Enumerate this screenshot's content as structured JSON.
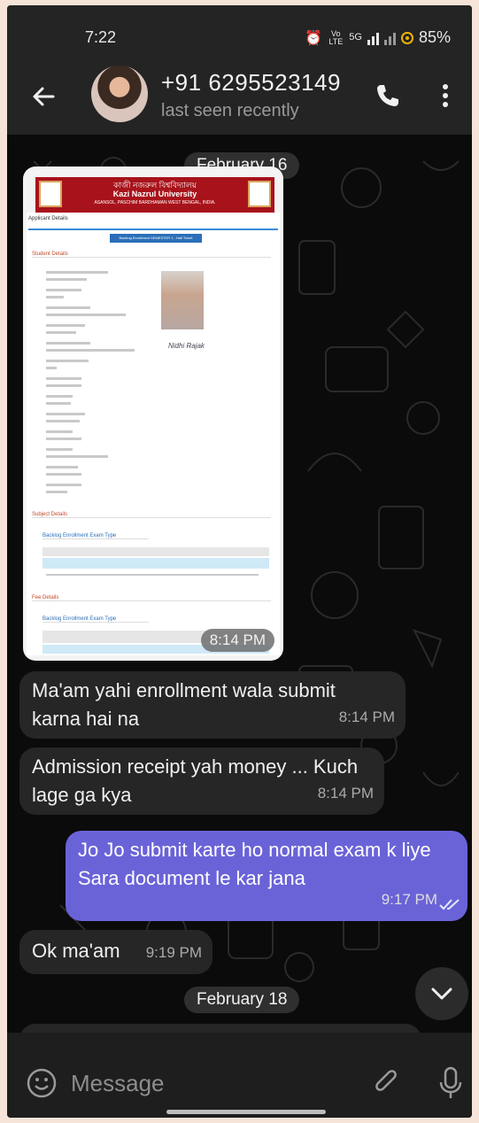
{
  "status_bar": {
    "time": "7:22",
    "volte": "Vo LTE",
    "network": "5G",
    "battery": "85%"
  },
  "header": {
    "contact": "+91 6295523149",
    "status": "last seen recently"
  },
  "dates": {
    "first": "February 16",
    "second": "February 18"
  },
  "document": {
    "univ_bengali": "কাজী নজরুল বিশ্ববিদ্যালয়",
    "univ_name": "Kazi Nazrul University",
    "univ_addr": "ASANSOL, PASCHIM BARDHAMAN WEST BENGAL, INDIA.",
    "tab": "Applicant Details",
    "button": "Backlog Enrollment SEMESTER 1 - Hall Ticket",
    "sec_student": "Student Details",
    "sec_subject": "Subject Details",
    "sec_fee": "Fee Details",
    "sub_exam_type": "Backlog Enrollment Exam Type",
    "signature": "Nidhi Rajak",
    "media_time": "8:14 PM"
  },
  "messages": [
    {
      "text": "Ma'am yahi enrollment wala submit karna hai na",
      "time": "8:14 PM",
      "dir": "in"
    },
    {
      "text": "Admission receipt yah money ... Kuch lage ga kya",
      "time": "8:14 PM",
      "dir": "in"
    },
    {
      "text": "Jo Jo submit karte ho normal exam k liye Sara document le kar jana",
      "time": "9:17 PM",
      "dir": "out"
    },
    {
      "text": "Ok ma'am",
      "time": "9:19 PM",
      "dir": "in"
    }
  ],
  "input": {
    "placeholder": "Message"
  },
  "colors": {
    "outgoing": "#6a63d8",
    "incoming": "#262626",
    "header": "#242424"
  }
}
